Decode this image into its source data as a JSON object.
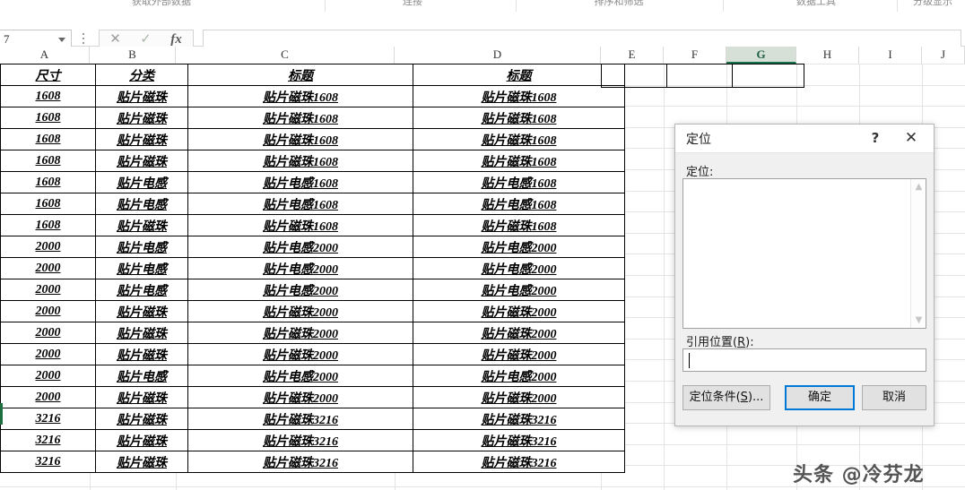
{
  "ribbon": {
    "groups": [
      "获取外部数据",
      "连接",
      "排序和筛选",
      "数据工具",
      "分级显示"
    ]
  },
  "formula_bar": {
    "name_box_value": "7",
    "cancel_icon": "cancel-x-icon",
    "confirm_icon": "confirm-check-icon",
    "function_icon": "fx",
    "formula_value": ""
  },
  "grid": {
    "column_headers": [
      "A",
      "B",
      "C",
      "D",
      "E",
      "F",
      "G",
      "H",
      "I",
      "J"
    ],
    "selected_column": "G",
    "table": {
      "headers": [
        "尺寸",
        "分类",
        "标题",
        "标题"
      ],
      "rows": [
        [
          "1608",
          "贴片磁珠",
          "贴片磁珠1608",
          "贴片磁珠1608"
        ],
        [
          "1608",
          "贴片磁珠",
          "贴片磁珠1608",
          "贴片磁珠1608"
        ],
        [
          "1608",
          "贴片磁珠",
          "贴片磁珠1608",
          "贴片磁珠1608"
        ],
        [
          "1608",
          "贴片磁珠",
          "贴片磁珠1608",
          "贴片磁珠1608"
        ],
        [
          "1608",
          "贴片电感",
          "贴片电感1608",
          "贴片电感1608"
        ],
        [
          "1608",
          "贴片电感",
          "贴片电感1608",
          "贴片电感1608"
        ],
        [
          "1608",
          "贴片磁珠",
          "贴片磁珠1608",
          "贴片磁珠1608"
        ],
        [
          "2000",
          "贴片电感",
          "贴片电感2000",
          "贴片电感2000"
        ],
        [
          "2000",
          "贴片电感",
          "贴片电感2000",
          "贴片电感2000"
        ],
        [
          "2000",
          "贴片电感",
          "贴片电感2000",
          "贴片电感2000"
        ],
        [
          "2000",
          "贴片磁珠",
          "贴片磁珠2000",
          "贴片磁珠2000"
        ],
        [
          "2000",
          "贴片磁珠",
          "贴片磁珠2000",
          "贴片磁珠2000"
        ],
        [
          "2000",
          "贴片磁珠",
          "贴片磁珠2000",
          "贴片磁珠2000"
        ],
        [
          "2000",
          "贴片电感",
          "贴片电感2000",
          "贴片电感2000"
        ],
        [
          "2000",
          "贴片磁珠",
          "贴片磁珠2000",
          "贴片磁珠2000"
        ],
        [
          "3216",
          "贴片磁珠",
          "贴片磁珠3216",
          "贴片磁珠3216"
        ],
        [
          "3216",
          "贴片磁珠",
          "贴片磁珠3216",
          "贴片磁珠3216"
        ],
        [
          "3216",
          "贴片磁珠",
          "贴片磁珠3216",
          "贴片磁珠3216"
        ]
      ]
    }
  },
  "dialog": {
    "title": "定位",
    "help_icon": "?",
    "close_icon": "✕",
    "list_label": "定位:",
    "list_items": [],
    "reference_label_pre": "引用位置(",
    "reference_label_key": "R",
    "reference_label_post": "):",
    "reference_value": "",
    "buttons": {
      "special_pre": "定位条件(",
      "special_key": "S",
      "special_post": ")...",
      "ok": "确定",
      "cancel": "取消"
    },
    "accent_color": "#0078d7"
  },
  "watermark": {
    "text": "头条 @冷芬龙"
  }
}
